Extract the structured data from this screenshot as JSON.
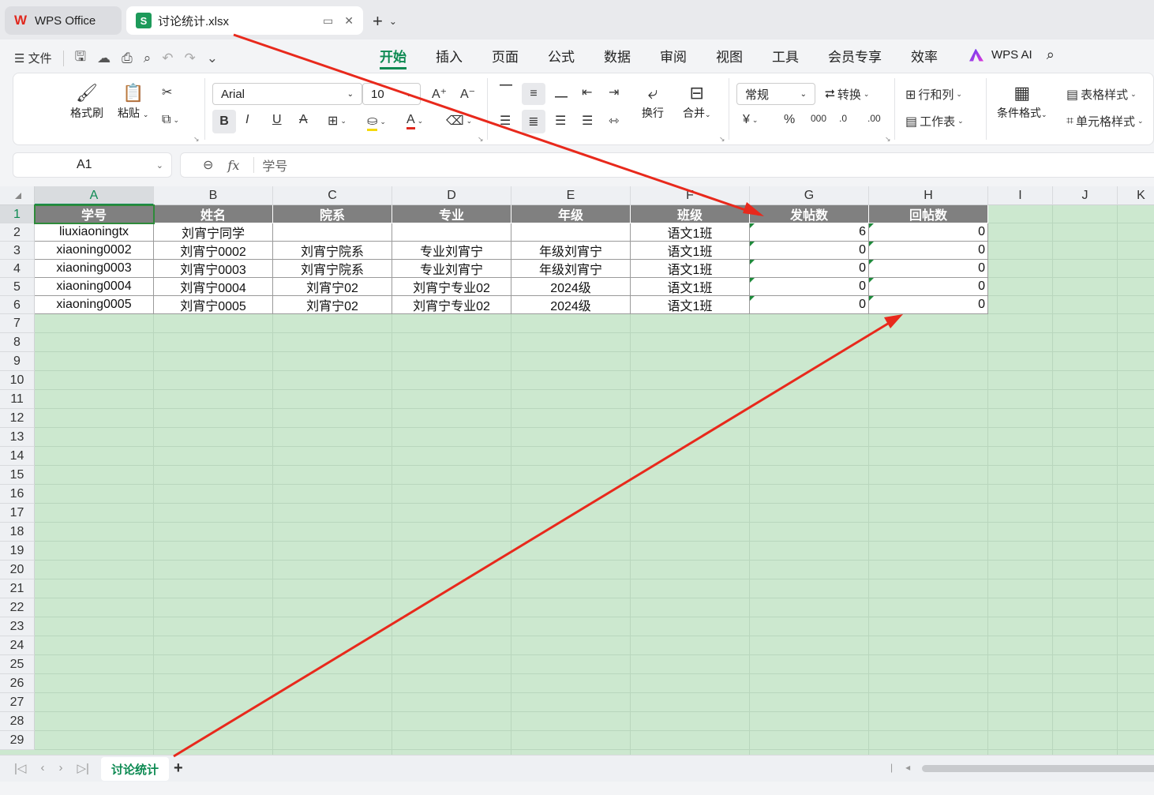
{
  "tabs": {
    "app": "WPS Office",
    "file": "讨论统计.xlsx"
  },
  "menu": {
    "file_label": "文件",
    "tabs": [
      "开始",
      "插入",
      "页面",
      "公式",
      "数据",
      "审阅",
      "视图",
      "工具",
      "会员专享",
      "效率"
    ],
    "ai_label": "WPS AI"
  },
  "ribbon": {
    "format_painter": "格式刷",
    "paste": "粘贴",
    "font_name": "Arial",
    "font_size": "10",
    "wrap": "换行",
    "merge": "合并",
    "number_format": "常规",
    "convert": "转换",
    "rows_cols": "行和列",
    "worksheet": "工作表",
    "cond_format": "条件格式",
    "table_style": "表格样式",
    "cell_style": "单元格样式"
  },
  "formula": {
    "cell_ref": "A1",
    "fx": "fx",
    "value": "学号"
  },
  "columns": [
    "A",
    "B",
    "C",
    "D",
    "E",
    "F",
    "G",
    "H",
    "I",
    "J",
    "K"
  ],
  "rows": [
    "1",
    "2",
    "3",
    "4",
    "5",
    "6",
    "7",
    "8",
    "9",
    "10",
    "11",
    "12",
    "13",
    "14",
    "15",
    "16",
    "17",
    "18",
    "19",
    "20",
    "21",
    "22",
    "23",
    "24",
    "25",
    "26",
    "27",
    "28",
    "29"
  ],
  "table": {
    "headers": [
      "学号",
      "姓名",
      "院系",
      "专业",
      "年级",
      "班级",
      "发帖数",
      "回帖数"
    ],
    "data": [
      [
        "liuxiaoningtx",
        "刘宵宁同学",
        "",
        "",
        "",
        "语文1班",
        "6",
        "0"
      ],
      [
        "xiaoning0002",
        "刘宵宁0002",
        "刘宵宁院系",
        "专业刘宵宁",
        "年级刘宵宁",
        "语文1班",
        "0",
        "0"
      ],
      [
        "xiaoning0003",
        "刘宵宁0003",
        "刘宵宁院系",
        "专业刘宵宁",
        "年级刘宵宁",
        "语文1班",
        "0",
        "0"
      ],
      [
        "xiaoning0004",
        "刘宵宁0004",
        "刘宵宁02",
        "刘宵宁专业02",
        "2024级",
        "语文1班",
        "0",
        "0"
      ],
      [
        "xiaoning0005",
        "刘宵宁0005",
        "刘宵宁02",
        "刘宵宁专业02",
        "2024级",
        "语文1班",
        "0",
        "0"
      ]
    ]
  },
  "sheet": {
    "active_tab": "讨论统计"
  },
  "colors": {
    "accent": "#0d8a52",
    "grid_bg": "#cce8cf",
    "header_fill": "#808080",
    "arrow": "#e8291c"
  }
}
